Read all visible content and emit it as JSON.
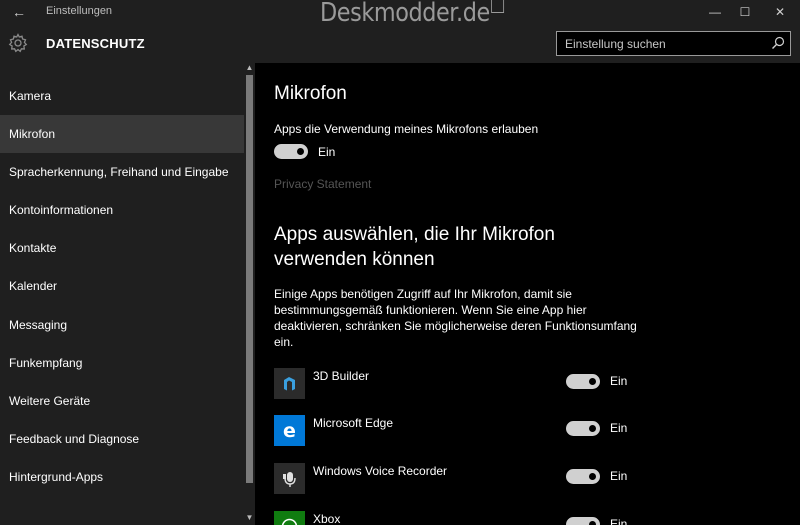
{
  "window": {
    "title": "Einstellungen",
    "back_glyph": "←",
    "minimize_glyph": "—",
    "maximize_glyph": "☐",
    "close_glyph": "✕",
    "watermark": "Deskmodder.de"
  },
  "header": {
    "icon": "gear-icon",
    "title": "DATENSCHUTZ",
    "search_placeholder": "Einstellung suchen",
    "search_icon": "search-icon"
  },
  "sidebar": {
    "items": [
      {
        "label": "Kamera",
        "active": false
      },
      {
        "label": "Mikrofon",
        "active": true
      },
      {
        "label": "Spracherkennung, Freihand und Eingabe",
        "active": false
      },
      {
        "label": "Kontoinformationen",
        "active": false
      },
      {
        "label": "Kontakte",
        "active": false
      },
      {
        "label": "Kalender",
        "active": false
      },
      {
        "label": "Messaging",
        "active": false
      },
      {
        "label": "Funkempfang",
        "active": false
      },
      {
        "label": "Weitere Geräte",
        "active": false
      },
      {
        "label": "Feedback und Diagnose",
        "active": false
      },
      {
        "label": "Hintergrund-Apps",
        "active": false
      }
    ]
  },
  "main": {
    "title": "Mikrofon",
    "master_option": {
      "label": "Apps die Verwendung meines Mikrofons erlauben",
      "state": "Ein",
      "on": true
    },
    "privacy_link": "Privacy Statement",
    "apps_heading": "Apps auswählen, die Ihr Mikrofon verwenden können",
    "apps_description": "Einige Apps benötigen Zugriff auf Ihr Mikrofon, damit sie bestimmungsgemäß funktionieren. Wenn Sie eine App hier deaktivieren, schränken Sie möglicherweise deren Funktionsumfang ein.",
    "apps": [
      {
        "name": "3D Builder",
        "state": "Ein",
        "on": true,
        "icon": "3d-builder-icon",
        "icon_bg": "#2b2b2b"
      },
      {
        "name": "Microsoft Edge",
        "state": "Ein",
        "on": true,
        "icon": "edge-icon",
        "icon_bg": "#0078d7"
      },
      {
        "name": "Windows Voice Recorder",
        "state": "Ein",
        "on": true,
        "icon": "voice-recorder-icon",
        "icon_bg": "#2b2b2b"
      },
      {
        "name": "Xbox",
        "state": "Ein",
        "on": true,
        "icon": "xbox-icon",
        "icon_bg": "#107c10"
      }
    ]
  },
  "colors": {
    "chrome_bg": "#1f1f1f",
    "main_bg": "#000000",
    "active_item_bg": "#383838",
    "toggle_on": "#d0d0d0",
    "link_disabled": "#555555"
  }
}
